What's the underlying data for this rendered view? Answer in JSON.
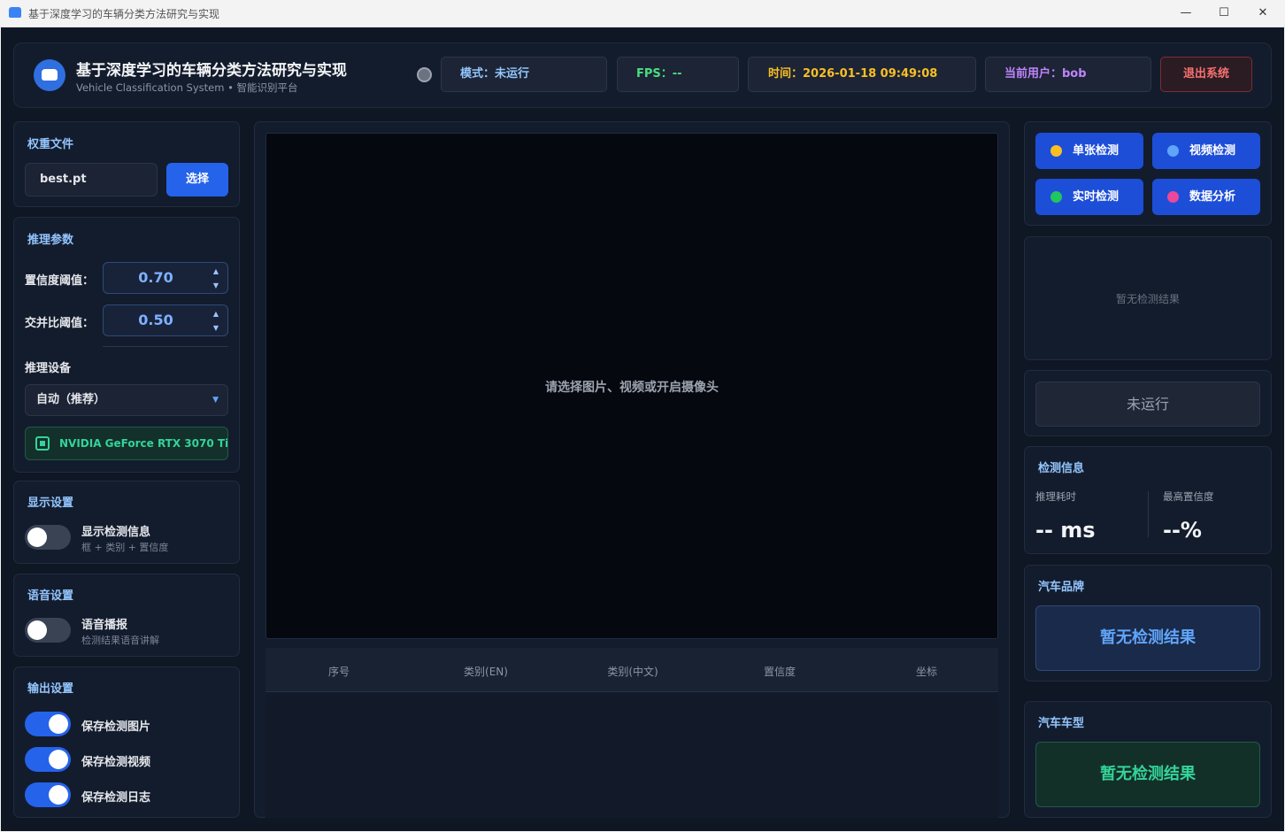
{
  "window": {
    "title": "基于深度学习的车辆分类方法研究与实现",
    "minimize_glyph": "—",
    "maximize_glyph": "☐",
    "close_glyph": "✕"
  },
  "header": {
    "title": "基于深度学习的车辆分类方法研究与实现",
    "subtitle": "Vehicle Classification System • 智能识别平台",
    "mode": "模式：未运行",
    "fps": "FPS：--",
    "time": "时间：2026-01-18 09:49:08",
    "user": "当前用户：bob",
    "logout": "退出系统"
  },
  "weights": {
    "heading": "权重文件",
    "file": "best.pt",
    "select_label": "选择"
  },
  "inference": {
    "heading": "推理参数",
    "conf_label": "置信度阈值：",
    "conf_value": "0.70",
    "iou_label": "交并比阈值：",
    "iou_value": "0.50",
    "spin_up": "▲",
    "spin_down": "▼",
    "device_label": "推理设备",
    "device_value": "自动（推荐）",
    "caret": "▼",
    "gpu": "NVIDIA GeForce RTX 3070 Ti"
  },
  "display": {
    "heading": "显示设置",
    "toggle_label": "显示检测信息",
    "toggle_sub": "框 + 类别 + 置信度",
    "toggle_on": false
  },
  "voice": {
    "heading": "语音设置",
    "toggle_label": "语音播报",
    "toggle_sub": "检测结果语音讲解",
    "toggle_on": false
  },
  "output": {
    "heading": "输出设置",
    "items": [
      {
        "label": "保存检测图片",
        "on": true
      },
      {
        "label": "保存检测视频",
        "on": true
      },
      {
        "label": "保存检测日志",
        "on": true
      }
    ]
  },
  "center": {
    "placeholder": "请选择图片、视频或开启摄像头",
    "table_headers": [
      "序号",
      "类别(EN)",
      "类别(中文)",
      "置信度",
      "坐标"
    ]
  },
  "modes": {
    "buttons": [
      {
        "label": "单张检测",
        "dot_color": "#fbbf24"
      },
      {
        "label": "视频检测",
        "dot_color": "#60a5fa"
      },
      {
        "label": "实时检测",
        "dot_color": "#22c55e"
      },
      {
        "label": "数据分析",
        "dot_color": "#ec4899"
      }
    ]
  },
  "result": {
    "empty": "暂无检测结果",
    "run_status": "未运行"
  },
  "detect_info": {
    "heading": "检测信息",
    "time_label": "推理耗时",
    "time_value": "-- ms",
    "conf_label": "最高置信度",
    "conf_value": "--%"
  },
  "brand": {
    "heading": "汽车品牌",
    "value": "暂无检测结果"
  },
  "model": {
    "heading": "汽车车型",
    "value": "暂无检测结果"
  },
  "colors": {
    "background": "#0f1624",
    "panel": "#131c2d",
    "accent": "#2563eb",
    "heading": "#93c5fd"
  }
}
